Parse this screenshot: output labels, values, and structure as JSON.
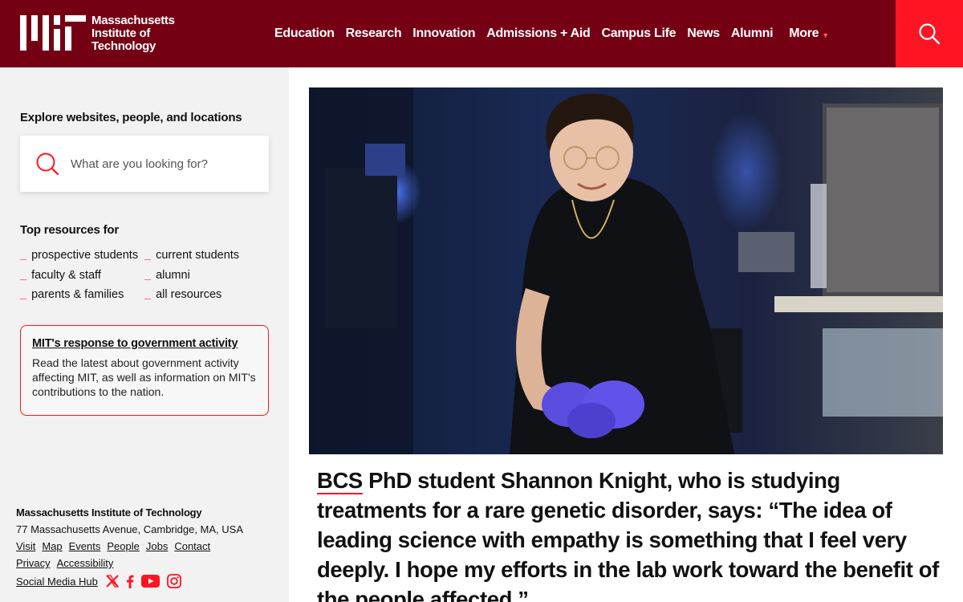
{
  "header": {
    "logo_lines": [
      "Massachusetts",
      "Institute of",
      "Technology"
    ],
    "nav": [
      "Education",
      "Research",
      "Innovation",
      "Admissions + Aid",
      "Campus Life",
      "News",
      "Alumni"
    ],
    "more_label": "More",
    "search_icon": "search-icon"
  },
  "sidebar": {
    "explore_title": "Explore websites, people, and locations",
    "search_placeholder": "What are you looking for?",
    "top_resources_title": "Top resources for",
    "resources_left": [
      "prospective students",
      "faculty & staff",
      "parents & families"
    ],
    "resources_right": [
      "current students",
      "alumni",
      "all resources"
    ],
    "alert": {
      "link": "MIT's response to government activity",
      "text": "Read the latest about government activity affecting MIT, as well as information on MIT's contributions to the nation."
    }
  },
  "footer": {
    "org": "Massachusetts Institute of Technology",
    "address": "77 Massachusetts Avenue, Cambridge, MA, USA",
    "links": [
      "Visit",
      "Map",
      "Events",
      "People",
      "Jobs",
      "Contact",
      "Privacy",
      "Accessibility"
    ],
    "social_hub": "Social Media Hub",
    "social_icons": [
      "x-icon",
      "facebook-icon",
      "youtube-icon",
      "instagram-icon"
    ]
  },
  "main": {
    "quote_link": "BCS",
    "quote_text": " PhD student Shannon Knight, who is studying treatments for a rare genetic disorder, says: “The idea of leading science with empathy is something that I feel very deeply. I hope my efforts in the lab work toward the benefit of the people affected.”"
  },
  "colors": {
    "header_bg": "#750014",
    "accent_red": "#ff1423",
    "sidebar_bg": "#f2f2f2"
  }
}
